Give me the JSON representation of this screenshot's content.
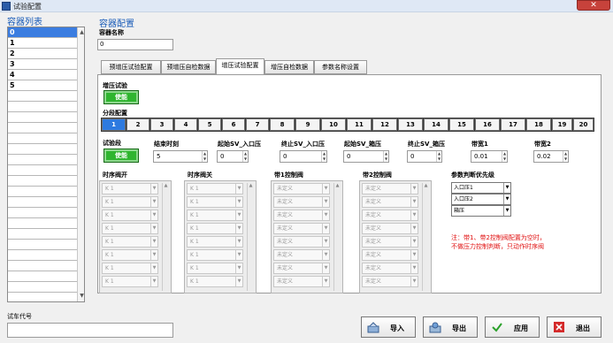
{
  "window": {
    "title": "试验配置",
    "close": "✕"
  },
  "container_list": {
    "header": "容器列表",
    "items": [
      "0",
      "1",
      "2",
      "3",
      "4",
      "5"
    ],
    "selected_index": 0
  },
  "config": {
    "header": "容器配置",
    "name_label": "容器名称",
    "name_value": "0"
  },
  "tabs": [
    "预增压试验配置",
    "预增压自检数据",
    "增压试验配置",
    "增压自检数据",
    "参数名称设置"
  ],
  "active_tab": 2,
  "boost": {
    "test_label": "增压试验",
    "enable_label": "使能",
    "segment_label": "分段配置",
    "segments": [
      "1",
      "2",
      "3",
      "4",
      "5",
      "6",
      "7",
      "8",
      "9",
      "10",
      "11",
      "12",
      "13",
      "14",
      "15",
      "16",
      "17",
      "18",
      "19",
      "20"
    ],
    "active_segment": 0,
    "seg_test_label": "试验段",
    "seg_enable_label": "使能",
    "fields": [
      {
        "label": "结束时刻",
        "value": "5"
      },
      {
        "label": "起始SV_入口压",
        "value": "0"
      },
      {
        "label": "终止SV_入口压",
        "value": "0"
      },
      {
        "label": "起始SV_箱压",
        "value": "0"
      },
      {
        "label": "终止SV_箱压",
        "value": "0"
      },
      {
        "label": "带宽1",
        "value": "0.01"
      },
      {
        "label": "带宽2",
        "value": "0.02"
      }
    ],
    "columns": [
      {
        "label": "时序阀开",
        "rows": [
          "K 1",
          "K 1",
          "K 1",
          "K 1",
          "K 1",
          "K 1",
          "K 1",
          "K 1"
        ]
      },
      {
        "label": "时序阀关",
        "rows": [
          "K 1",
          "K 1",
          "K 1",
          "K 1",
          "K 1",
          "K 1",
          "K 1",
          "K 1"
        ]
      },
      {
        "label": "带1控制阀",
        "rows": [
          "未定义",
          "未定义",
          "未定义",
          "未定义",
          "未定义",
          "未定义",
          "未定义",
          "未定义"
        ]
      },
      {
        "label": "带2控制阀",
        "rows": [
          "未定义",
          "未定义",
          "未定义",
          "未定义",
          "未定义",
          "未定义",
          "未定义",
          "未定义"
        ]
      }
    ],
    "priority_label": "参数判断优先级",
    "priority": [
      "入口压1",
      "入口压2",
      "箱压"
    ],
    "note_lines": [
      "注：带1、带2控制阀配置为空时，",
      "不做压力控制判断，只动作时序阀"
    ]
  },
  "footer": {
    "code_label": "试车代号",
    "code_value": "",
    "import": "导入",
    "export": "导出",
    "apply": "应用",
    "exit": "退出"
  }
}
